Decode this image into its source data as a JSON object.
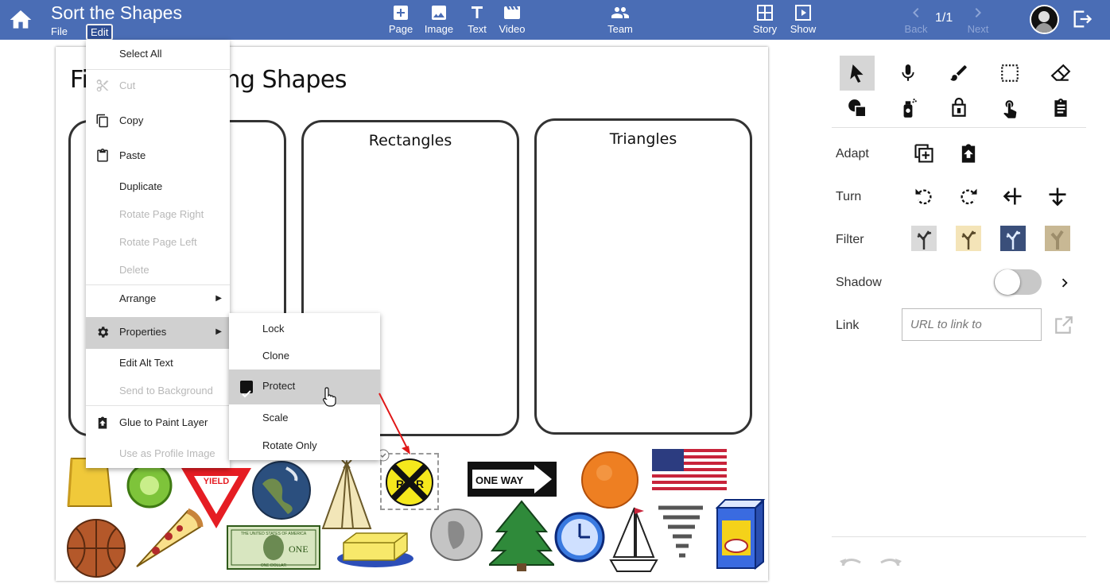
{
  "app": {
    "title": "Sort the Shapes",
    "menus": [
      "File",
      "Edit"
    ],
    "colors": {
      "header": "#4a6db5",
      "menu_active": "#d0d0d0"
    }
  },
  "toolbar": {
    "center": [
      {
        "label": "Page",
        "icon": "add-page-icon"
      },
      {
        "label": "Image",
        "icon": "image-icon"
      },
      {
        "label": "Text",
        "icon": "text-icon"
      },
      {
        "label": "Video",
        "icon": "video-icon"
      }
    ],
    "team": {
      "label": "Team",
      "icon": "team-icon"
    },
    "right": [
      {
        "label": "Story",
        "icon": "story-grid-icon"
      },
      {
        "label": "Show",
        "icon": "play-icon"
      }
    ],
    "nav": {
      "back": "Back",
      "next": "Next",
      "page_count": "1/1"
    }
  },
  "canvas": {
    "heading_left": "Fi",
    "heading_right": "rting Shapes",
    "boxes": [
      "Rectangles",
      "Triangles"
    ],
    "yield_text": "YIELD",
    "rr_letters": [
      "R",
      "R"
    ],
    "one_way_text": "ONE WAY",
    "bill_text": "ONE",
    "bill_top_text": "THE UNITED STATES OF AMERICA",
    "bill_bottom_text": "ONE DOLLAR"
  },
  "edit_menu": {
    "items": [
      {
        "label": "Select All",
        "icon": "",
        "disabled": false
      },
      {
        "label": "Cut",
        "icon": "scissors-icon",
        "disabled": true
      },
      {
        "label": "Copy",
        "icon": "copy-icon",
        "disabled": false
      },
      {
        "label": "Paste",
        "icon": "clipboard-icon",
        "disabled": false
      },
      {
        "label": "Duplicate",
        "icon": "",
        "disabled": false
      },
      {
        "label": "Rotate Page Right",
        "icon": "",
        "disabled": true
      },
      {
        "label": "Rotate Page Left",
        "icon": "",
        "disabled": true
      },
      {
        "label": "Delete",
        "icon": "",
        "disabled": true
      },
      {
        "label": "Arrange",
        "icon": "",
        "disabled": false,
        "submenu": true
      },
      {
        "label": "Properties",
        "icon": "gear-icon",
        "disabled": false,
        "submenu": true,
        "active": true
      },
      {
        "label": "Edit Alt Text",
        "icon": "",
        "disabled": false
      },
      {
        "label": "Send to Background",
        "icon": "",
        "disabled": true
      },
      {
        "label": "Glue to Paint Layer",
        "icon": "glue-icon",
        "disabled": false
      },
      {
        "label": "Use as Profile Image",
        "icon": "",
        "disabled": true
      }
    ]
  },
  "properties_submenu": {
    "items": [
      {
        "label": "Lock",
        "checked": false
      },
      {
        "label": "Clone",
        "checked": false
      },
      {
        "label": "Protect",
        "checked": true
      },
      {
        "label": "Scale",
        "checked": false
      },
      {
        "label": "Rotate Only",
        "checked": false
      }
    ]
  },
  "panel": {
    "tools_row1": [
      "pointer-icon",
      "microphone-icon",
      "brush-icon",
      "marquee-select-icon",
      "eraser-icon"
    ],
    "tools_row2": [
      "shapes-icon",
      "spray-can-icon",
      "paint-bucket-icon",
      "touch-icon",
      "clipboard-icon"
    ],
    "adapt": {
      "label": "Adapt",
      "icons": [
        "add-copy-icon",
        "glue-icon"
      ]
    },
    "turn": {
      "label": "Turn",
      "icons": [
        "rotate-left-icon",
        "rotate-right-icon",
        "flip-horizontal-icon",
        "flip-vertical-icon"
      ]
    },
    "filter": {
      "label": "Filter",
      "icons": [
        "filter-grayscale-icon",
        "filter-sepia-icon",
        "filter-invert-icon",
        "filter-blur-icon"
      ]
    },
    "shadow": {
      "label": "Shadow",
      "enabled": false
    },
    "link": {
      "label": "Link",
      "placeholder": "URL to link to"
    }
  }
}
